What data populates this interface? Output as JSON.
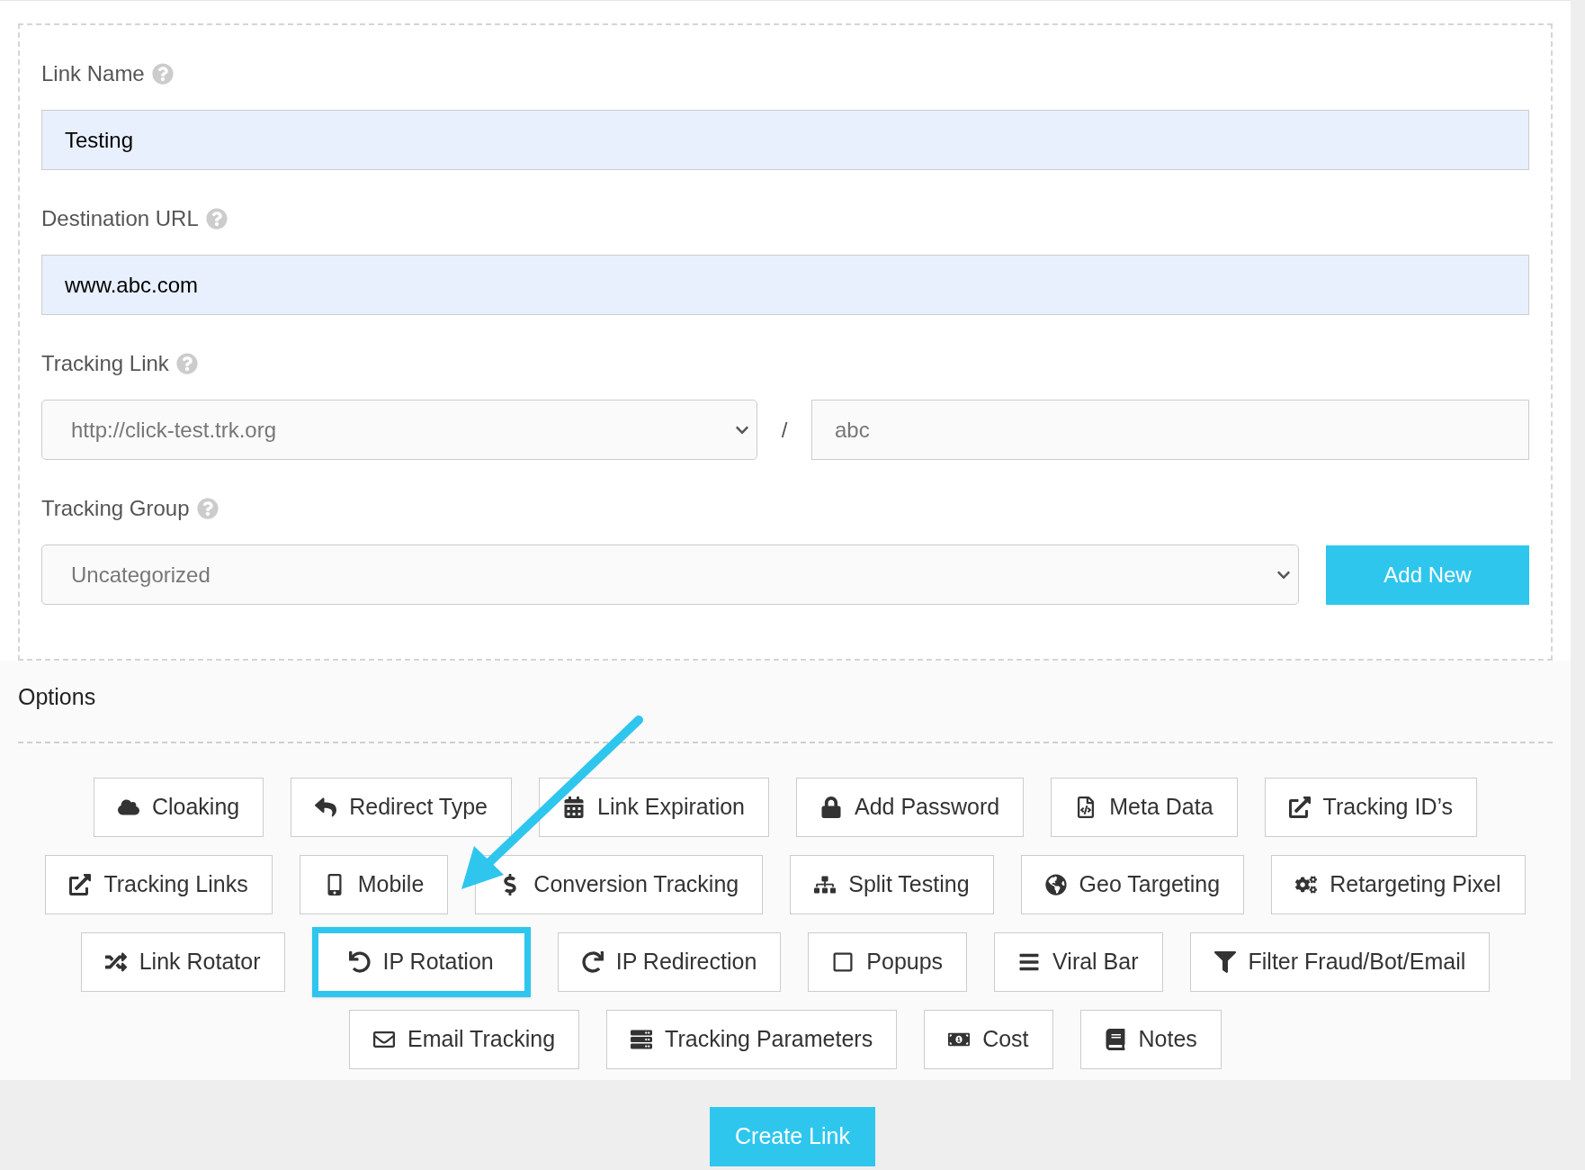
{
  "form": {
    "link_name": {
      "label": "Link Name",
      "value": "Testing"
    },
    "destination_url": {
      "label": "Destination URL",
      "value": "www.abc.com"
    },
    "tracking_link": {
      "label": "Tracking Link",
      "domain": "http://click-test.trk.org",
      "separator": "/",
      "slug": "abc"
    },
    "tracking_group": {
      "label": "Tracking Group",
      "value": "Uncategorized",
      "add_button": "Add New"
    }
  },
  "options": {
    "title": "Options",
    "buttons": [
      {
        "label": "Cloaking",
        "highlighted": false
      },
      {
        "label": "Redirect Type",
        "highlighted": false
      },
      {
        "label": "Link Expiration",
        "highlighted": false
      },
      {
        "label": "Add Password",
        "highlighted": false
      },
      {
        "label": "Meta Data",
        "highlighted": false
      },
      {
        "label": "Tracking ID’s",
        "highlighted": false
      },
      {
        "label": "Tracking Links",
        "highlighted": false
      },
      {
        "label": "Mobile",
        "highlighted": false
      },
      {
        "label": "Conversion Tracking",
        "highlighted": false
      },
      {
        "label": "Split Testing",
        "highlighted": false
      },
      {
        "label": "Geo Targeting",
        "highlighted": false
      },
      {
        "label": "Retargeting Pixel",
        "highlighted": false
      },
      {
        "label": "Link Rotator",
        "highlighted": false
      },
      {
        "label": "IP Rotation",
        "highlighted": true
      },
      {
        "label": "IP Redirection",
        "highlighted": false
      },
      {
        "label": "Popups",
        "highlighted": false
      },
      {
        "label": "Viral Bar",
        "highlighted": false
      },
      {
        "label": "Filter Fraud/Bot/Email",
        "highlighted": false
      },
      {
        "label": "Email Tracking",
        "highlighted": false
      },
      {
        "label": "Tracking Parameters",
        "highlighted": false
      },
      {
        "label": "Cost",
        "highlighted": false
      },
      {
        "label": "Notes",
        "highlighted": false
      }
    ]
  },
  "footer": {
    "create_button": "Create Link"
  }
}
